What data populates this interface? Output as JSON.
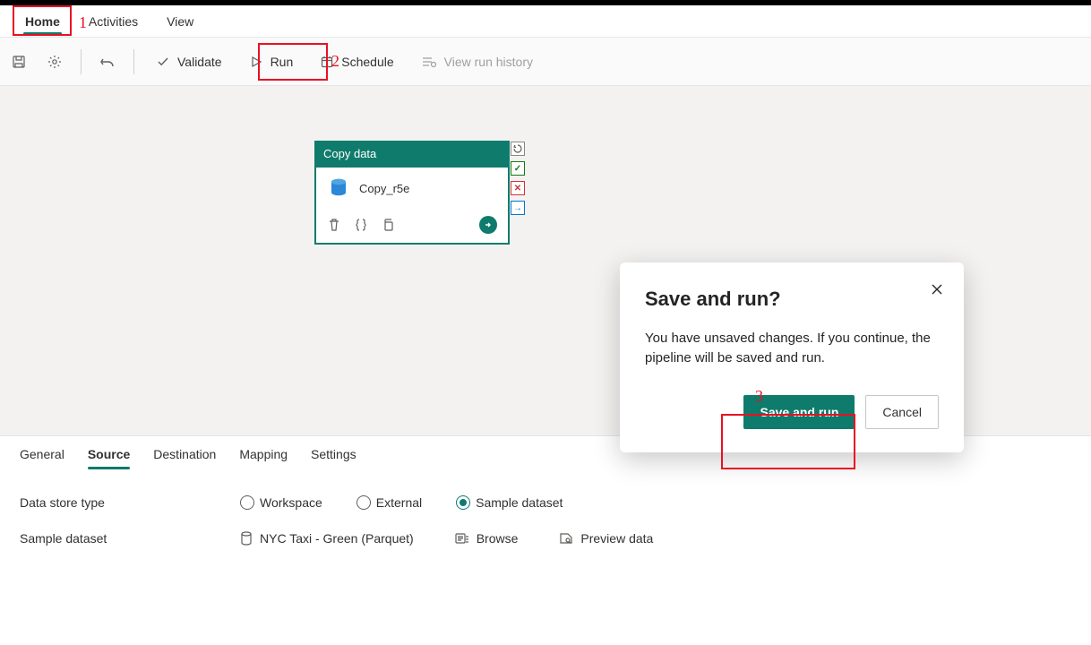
{
  "annotations": {
    "n1": "1",
    "n2": "2",
    "n3": "3"
  },
  "ribbon": {
    "tabs": [
      "Home",
      "Activities",
      "View"
    ],
    "active": 0
  },
  "toolbar": {
    "validate": "Validate",
    "run": "Run",
    "schedule": "Schedule",
    "history": "View run history"
  },
  "activity": {
    "type_label": "Copy data",
    "name": "Copy_r5e"
  },
  "properties": {
    "tabs": [
      "General",
      "Source",
      "Destination",
      "Mapping",
      "Settings"
    ],
    "active": 1,
    "data_store_type_label": "Data store type",
    "options": {
      "workspace": "Workspace",
      "external": "External",
      "sample": "Sample dataset"
    },
    "selected_option": "sample",
    "sample_dataset_label": "Sample dataset",
    "sample_dataset_value": "NYC Taxi - Green (Parquet)",
    "browse": "Browse",
    "preview": "Preview data"
  },
  "dialog": {
    "title": "Save and run?",
    "body": "You have unsaved changes. If you continue, the pipeline will be saved and run.",
    "primary": "Save and run",
    "secondary": "Cancel"
  }
}
